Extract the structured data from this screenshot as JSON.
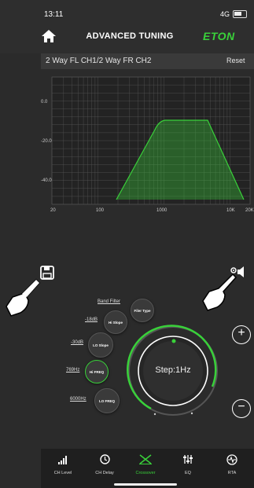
{
  "status": {
    "time": "13:11",
    "signal": "4G"
  },
  "header": {
    "title": "ADVANCED TUNING",
    "logo": "ETON"
  },
  "channel": {
    "label": "2 Way FL CH1/2 Way FR CH2",
    "reset": "Reset"
  },
  "graph": {
    "y_ticks": [
      "0.0",
      "-20.0",
      "-40.0"
    ],
    "x_ticks": [
      "20",
      "100",
      "1000",
      "10K",
      "20K"
    ]
  },
  "controls": {
    "band_filter": "Band Filter",
    "filter_type": "Filer Type",
    "hi_slope_value": "-18dB",
    "hi_slope": "Hi Slope",
    "lo_slope_value": "-30dB",
    "lo_slope": "LO Slope",
    "hi_freq_value": "769Hz",
    "hi_freq": "Hi FREQ",
    "lo_freq_value": "6000Hz",
    "lo_freq": "LO FREQ",
    "step": "Step:1Hz"
  },
  "tabs": [
    {
      "label": "CH Level",
      "icon": "bars-icon"
    },
    {
      "label": "CH Delay",
      "icon": "clock-icon"
    },
    {
      "label": "Crossover",
      "icon": "crossover-icon"
    },
    {
      "label": "EQ",
      "icon": "sliders-icon"
    },
    {
      "label": "RTA",
      "icon": "pulse-icon"
    }
  ],
  "colors": {
    "accent": "#39d13a",
    "background": "#2b2b2b"
  }
}
